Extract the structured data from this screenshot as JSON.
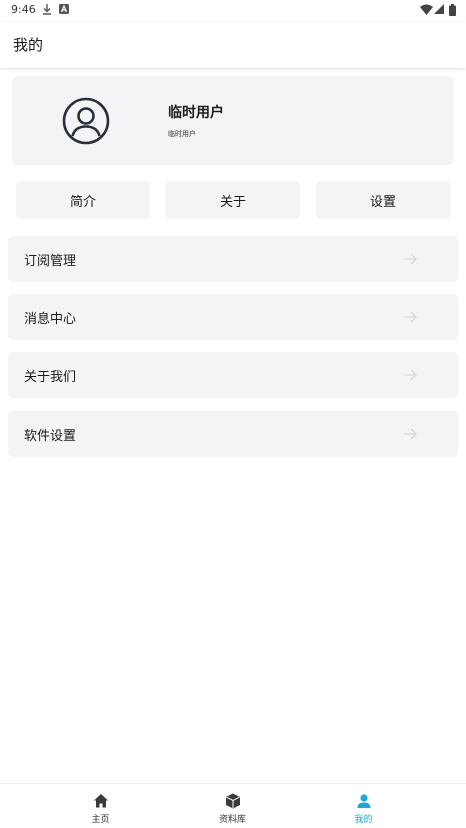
{
  "status_bar": {
    "time": "9:46",
    "icons": [
      "download-icon",
      "a-icon",
      "wifi-icon",
      "signal-icon",
      "battery-icon"
    ]
  },
  "header": {
    "title": "我的"
  },
  "profile": {
    "avatar_icon": "user-circle-icon",
    "name": "临时用户",
    "subtitle": "临时用户"
  },
  "quick_actions": [
    {
      "label": "简介"
    },
    {
      "label": "关于"
    },
    {
      "label": "设置"
    }
  ],
  "menu": [
    {
      "label": "订阅管理",
      "icon": "arrow-right-icon"
    },
    {
      "label": "消息中心",
      "icon": "arrow-right-icon"
    },
    {
      "label": "关于我们",
      "icon": "arrow-right-icon"
    },
    {
      "label": "软件设置",
      "icon": "arrow-right-icon"
    }
  ],
  "bottom_nav": {
    "items": [
      {
        "label": "主页",
        "icon": "home-icon",
        "active": false
      },
      {
        "label": "资料库",
        "icon": "box-icon",
        "active": false
      },
      {
        "label": "我的",
        "icon": "person-icon",
        "active": true
      }
    ],
    "active_color": "#1ba8d8",
    "inactive_color": "#333333"
  }
}
